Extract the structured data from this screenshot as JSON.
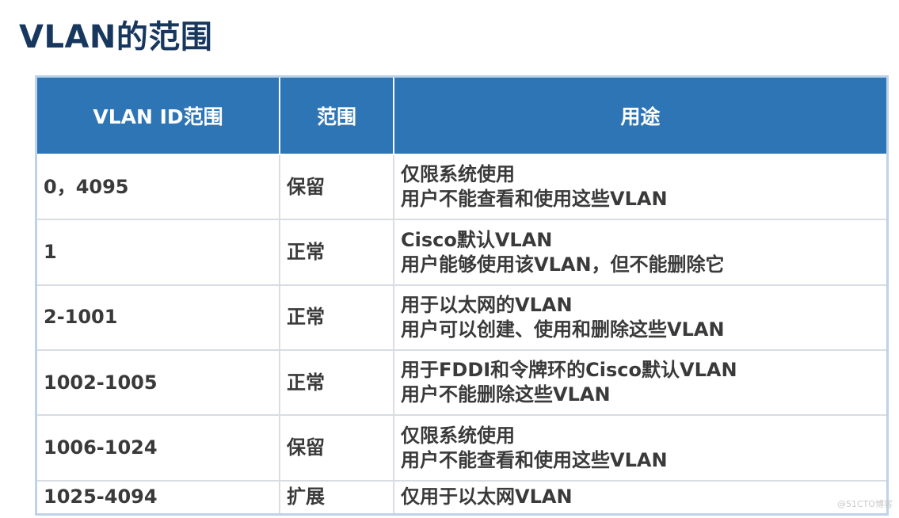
{
  "title": "VLAN的范围",
  "table": {
    "headers": [
      "VLAN ID范围",
      "范围",
      "用途"
    ],
    "rows": [
      {
        "id_range": "0，4095",
        "range": "保留",
        "usage": [
          "仅限系统使用",
          "用户不能查看和使用这些VLAN"
        ]
      },
      {
        "id_range": "1",
        "range": "正常",
        "usage": [
          "Cisco默认VLAN",
          "用户能够使用该VLAN，但不能删除它"
        ]
      },
      {
        "id_range": "2-1001",
        "range": "正常",
        "usage": [
          "用于以太网的VLAN",
          "用户可以创建、使用和删除这些VLAN"
        ]
      },
      {
        "id_range": "1002-1005",
        "range": "正常",
        "usage": [
          "用于FDDI和令牌环的Cisco默认VLAN",
          "用户不能删除这些VLAN"
        ]
      },
      {
        "id_range": "1006-1024",
        "range": "保留",
        "usage": [
          "仅限系统使用",
          "用户不能查看和使用这些VLAN"
        ]
      },
      {
        "id_range": "1025-4094",
        "range": "扩展",
        "usage": [
          "仅用于以太网VLAN"
        ]
      }
    ]
  },
  "watermark": "@51CTO博客",
  "colors": {
    "title": "#17375e",
    "header_bg": "#2e75b6",
    "header_text": "#ffffff",
    "table_border": "#bed3ea",
    "grid": "#d8dde3",
    "body_text": "#3a3a3a"
  }
}
